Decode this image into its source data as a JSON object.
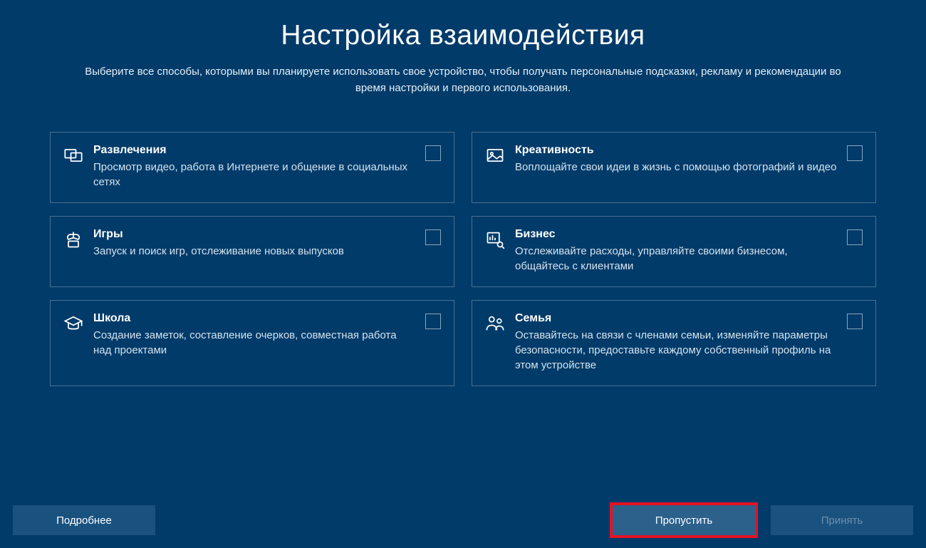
{
  "header": {
    "title": "Настройка взаимодействия",
    "subtitle": "Выберите все способы, которыми вы планируете использовать свое устройство, чтобы получать персональные подсказки, рекламу и рекомендации во время настройки и первого использования."
  },
  "options": [
    {
      "icon": "entertainment",
      "title": "Развлечения",
      "desc": "Просмотр видео, работа в Интернете и общение в социальных сетях"
    },
    {
      "icon": "creativity",
      "title": "Креативность",
      "desc": "Воплощайте свои идеи в жизнь с помощью фотографий и видео"
    },
    {
      "icon": "gaming",
      "title": "Игры",
      "desc": "Запуск и поиск игр, отслеживание новых выпусков"
    },
    {
      "icon": "business",
      "title": "Бизнес",
      "desc": "Отслеживайте расходы, управляйте своими бизнесом, общайтесь с клиентами"
    },
    {
      "icon": "school",
      "title": "Школа",
      "desc": "Создание заметок, составление очерков, совместная работа над проектами"
    },
    {
      "icon": "family",
      "title": "Семья",
      "desc": "Оставайтесь на связи с членами семьи, изменяйте параметры безопасности, предоставьте каждому собственный профиль на этом устройстве"
    }
  ],
  "footer": {
    "more": "Подробнее",
    "skip": "Пропустить",
    "accept": "Принять"
  }
}
